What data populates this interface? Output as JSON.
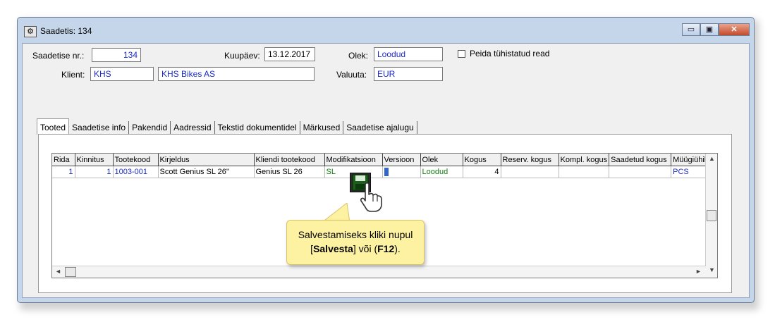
{
  "window": {
    "title": "Saadetis: 134",
    "icon": "document-gear-icon",
    "controls": {
      "minimize": "▭",
      "maximize": "▣",
      "close": "✕"
    }
  },
  "form": {
    "shipment_no_label": "Saadetise nr.:",
    "shipment_no": "134",
    "date_label": "Kuupäev:",
    "date": "13.12.2017",
    "status_label": "Olek:",
    "status": "Loodud",
    "hide_cancelled_label": "Peida tühistatud read",
    "hide_cancelled_checked": false,
    "client_label": "Klient:",
    "client_code": "KHS",
    "client_name": "KHS Bikes AS",
    "currency_label": "Valuuta:",
    "currency": "EUR"
  },
  "tabs": [
    {
      "label": "Tooted",
      "active": true
    },
    {
      "label": "Saadetise info"
    },
    {
      "label": "Pakendid"
    },
    {
      "label": "Aadressid"
    },
    {
      "label": "Tekstid dokumentidel"
    },
    {
      "label": "Märkused"
    },
    {
      "label": "Saadetise ajalugu"
    }
  ],
  "grid": {
    "columns": [
      "Rida",
      "Kinnitus",
      "Tootekood",
      "Kirjeldus",
      "Kliendi tootekood",
      "Modifikatsioon",
      "Versioon",
      "Olek",
      "Kogus",
      "Reserv. kogus",
      "Kompl. kogus",
      "Saadetud kogus",
      "Müügiühik"
    ],
    "rows": [
      {
        "rida": "1",
        "kinnitus": "1",
        "tootekood": "1003-001",
        "kirjeldus": "Scott Genius SL 26''",
        "kliendi_tootekood": "Genius SL 26",
        "modifikatsioon": "SL",
        "versioon": "",
        "olek": "Loodud",
        "kogus": "4",
        "reserv_kogus": "",
        "kompl_kogus": "",
        "saadetud_kogus": "",
        "muugiuhik": "PCS"
      }
    ]
  },
  "tooltip": {
    "line1": "Salvestamiseks kliki nupul",
    "open_bracket": "[",
    "button_name": "Salvesta",
    "middle": "] või (",
    "key": "F12",
    "end": ")."
  },
  "colors": {
    "accent_text": "#1a2bc8",
    "status_green": "#108010",
    "tooltip_bg": "#fdf2a1"
  }
}
